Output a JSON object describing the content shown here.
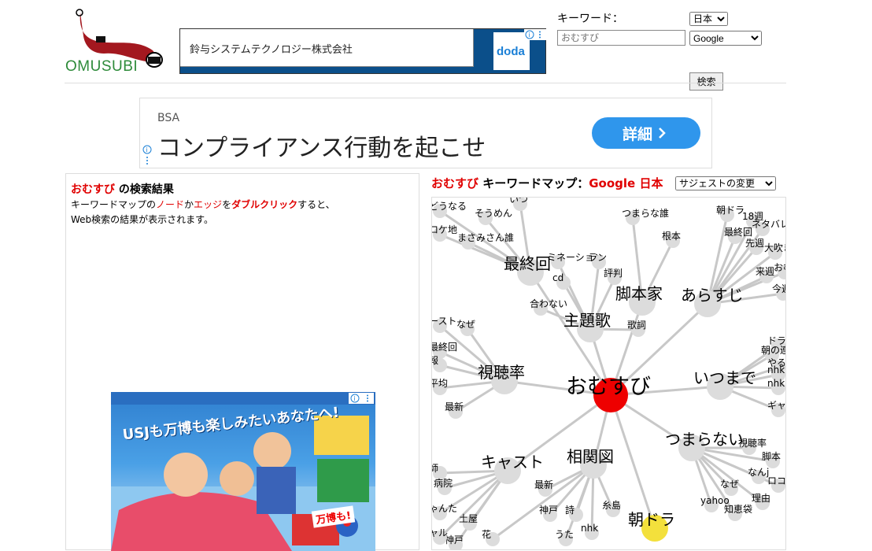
{
  "logo": {
    "text": "OMUSUBI"
  },
  "top_ad": {
    "company": "鈴与システムテクノロジー株式会社",
    "brand": "doda"
  },
  "search": {
    "keyword_label": "キーワード：",
    "input_placeholder": "おむすび",
    "language": "日本",
    "engine": "Google",
    "button_label": "検索"
  },
  "mid_ad": {
    "brand": "BSA",
    "headline": "コンプライアンス行動を起こせ",
    "cta": "詳細"
  },
  "results": {
    "keyword": "おむすび",
    "title_suffix": " の検索結果",
    "desc_1": "キーワードマップの",
    "desc_node": "ノード",
    "desc_or": "か",
    "desc_edge": "エッジ",
    "desc_wo": "を",
    "desc_dbl": "ダブルクリック",
    "desc_tail": "すると、",
    "desc_line2": "Web検索の結果が表示されます。"
  },
  "usj_ad": {
    "headline": "USJも万博も楽しみたいあなたへ!",
    "tag": "万博も!"
  },
  "map_header": {
    "keyword": "おむすび",
    "label": " キーワードマップ：",
    "engine_lang": "Google 日本",
    "suggest_option": "サジェストの変更"
  },
  "map": {
    "center": {
      "label": "おむすび",
      "color": "#ee0000"
    },
    "nodes": [
      {
        "id": "最終回",
        "label": "最終回",
        "size": "big"
      },
      {
        "id": "脚本家",
        "label": "脚本家",
        "size": "big"
      },
      {
        "id": "あらすじ",
        "label": "あらすじ",
        "size": "big"
      },
      {
        "id": "主題歌",
        "label": "主題歌",
        "size": "big"
      },
      {
        "id": "視聴率",
        "label": "視聴率",
        "size": "big"
      },
      {
        "id": "いつまで",
        "label": "いつまで",
        "size": "big"
      },
      {
        "id": "つまらない",
        "label": "つまらない",
        "size": "big"
      },
      {
        "id": "キャスト",
        "label": "キャスト",
        "size": "big"
      },
      {
        "id": "相関図",
        "label": "相関図",
        "size": "big"
      },
      {
        "id": "朝ドラ",
        "label": "朝ドラ",
        "size": "big",
        "color": "#f3e03c"
      }
    ],
    "leaves": [
      {
        "parent": "最終回",
        "labels": [
          "どうなる",
          "いつ",
          "そうめん",
          "ロケ地",
          "まさみさん誰"
        ]
      },
      {
        "parent": "主題歌",
        "labels": [
          "ミネーション",
          "cd",
          "合わない",
          "歌詞",
          "評判",
          "ラン"
        ]
      },
      {
        "parent": "脚本家",
        "labels": [
          "つまらな誰",
          "根本"
        ]
      },
      {
        "parent": "あらすじ",
        "labels": [
          "朝ドラ",
          "18週",
          "最終回",
          "ネタバレ",
          "先週",
          "来週",
          "今週",
          "大吹き出し",
          "おむ"
        ]
      },
      {
        "parent": "視聴率",
        "labels": [
          "ースト",
          "なぜ",
          "最終回",
          "報",
          "平均",
          "最新"
        ]
      },
      {
        "parent": "いつまで",
        "labels": [
          "ドラマ",
          "朝の連",
          "やる",
          "nhk",
          "nhk",
          "ギャル"
        ]
      },
      {
        "parent": "つまらない",
        "labels": [
          "視聴率",
          "脚本",
          "なんj",
          "ロコミ",
          "なぜ",
          "yahoo",
          "知恵袋",
          "理由"
        ]
      },
      {
        "parent": "キャスト",
        "labels": [
          "師",
          "病院",
          "ゃんた",
          "土屋",
          "神戸",
          "ャル"
        ]
      },
      {
        "parent": "相関図",
        "labels": [
          "最新",
          "神戸",
          "詩",
          "糸島",
          "nhk",
          "うた",
          "花"
        ]
      }
    ]
  },
  "colors": {
    "accent_red": "#e00000",
    "logo_green": "#2e8b3a",
    "cta_blue": "#2f96ec"
  }
}
